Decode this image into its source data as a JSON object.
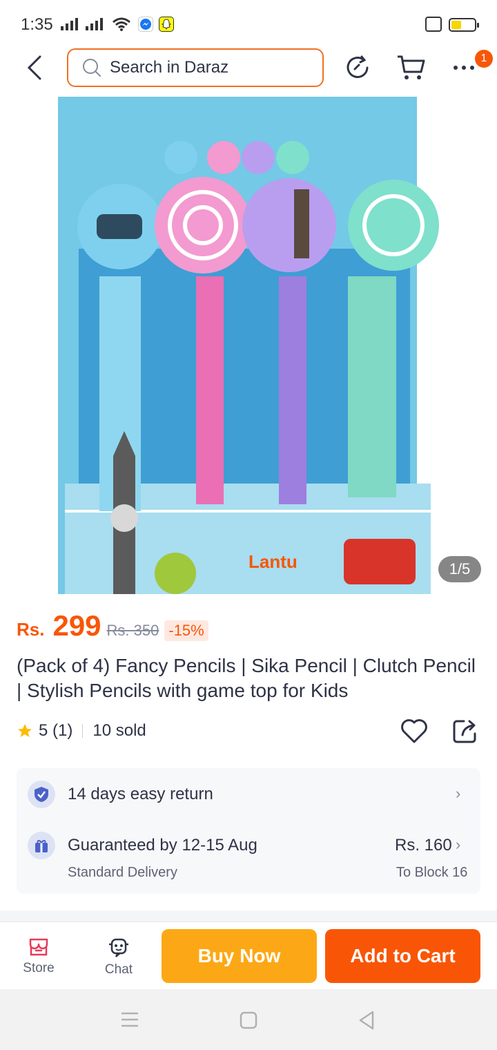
{
  "status": {
    "time": "1:35",
    "battery_level": 0.45
  },
  "header": {
    "search_placeholder": "Search in Daraz",
    "notification_count": "1"
  },
  "product": {
    "image_counter": "1/5",
    "currency": "Rs.",
    "price": "299",
    "old_price": "Rs. 350",
    "discount": "-15%",
    "title": "(Pack of 4) Fancy Pencils | Sika Pencil | Clutch Pencil | Stylish Pencils with game top for Kids",
    "rating": "5 (1)",
    "sold": "10 sold",
    "image_brand": "Lantu"
  },
  "info": {
    "return_text": "14 days easy return",
    "delivery_text": "Guaranteed by 12-15 Aug",
    "delivery_type": "Standard Delivery",
    "delivery_price": "Rs. 160",
    "delivery_to": "To Block 16"
  },
  "bottom": {
    "store_label": "Store",
    "chat_label": "Chat",
    "buy_now_label": "Buy Now",
    "add_to_cart_label": "Add to Cart"
  },
  "colors": {
    "accent": "#f85606",
    "buy_now": "#fca816",
    "search_border": "#f36f21"
  }
}
